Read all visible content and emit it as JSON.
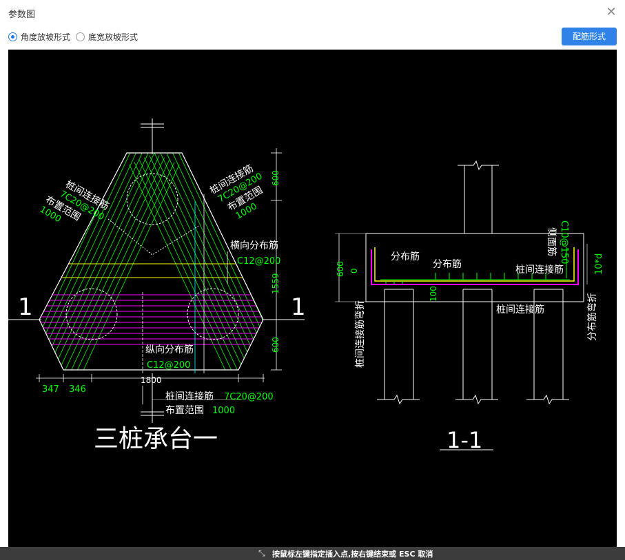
{
  "window": {
    "title": "参数图"
  },
  "options": [
    {
      "label": "角度放坡形式",
      "checked": true
    },
    {
      "label": "底宽放坡形式",
      "checked": false
    }
  ],
  "toolbar": {
    "config_label": "配筋形式"
  },
  "drawing": {
    "left": {
      "title": "三桩承台一",
      "section_mark": "1",
      "labels": {
        "pile_rebar_left_1": "桩间连接筋",
        "pile_rebar_left_2": "7C20@200",
        "range_left_1": "布置范围",
        "range_left_2": "1000",
        "pile_rebar_right_1": "桩间连接筋",
        "pile_rebar_right_2": "7C20@200",
        "range_right_1": "布置范围",
        "range_right_2": "1000",
        "transverse": "横向分布筋",
        "transverse_spec": "C12@200",
        "longitudinal": "纵向分布筋",
        "longitudinal_spec": "C12@200",
        "bottom_rebar_1": "桩间连接筋",
        "bottom_rebar_2": "7C20@200",
        "bottom_range_1": "布置范围",
        "bottom_range_2": "1000"
      },
      "dims": {
        "d600_top": "600",
        "d1559": "1559",
        "d600_bottom": "600",
        "d1800": "1800",
        "d347": "347",
        "d346": "346"
      }
    },
    "right": {
      "title": "1-1",
      "labels": {
        "dist1": "分布筋",
        "dist2": "分布筋",
        "side": "侧面筋",
        "side_spec": "C10@150",
        "pile_conn": "桩间连接筋",
        "pile_conn2": "桩间连接筋",
        "pile_bend": "桩间连接筋弯折",
        "dist_bend": "分布筋弯折",
        "ten_d": "10*d"
      },
      "dims": {
        "d600": "600",
        "d0": "0",
        "d100": "100"
      }
    }
  },
  "status": {
    "text": "按鼠标左键指定插入点,按右键结束或 ESC 取消"
  },
  "colors": {
    "accent": "#2f83e8",
    "canvas": "#000000",
    "green": "#00ff00",
    "magenta": "#ff00ff",
    "yellow": "#ffff00",
    "cyan": "#00ffff"
  }
}
